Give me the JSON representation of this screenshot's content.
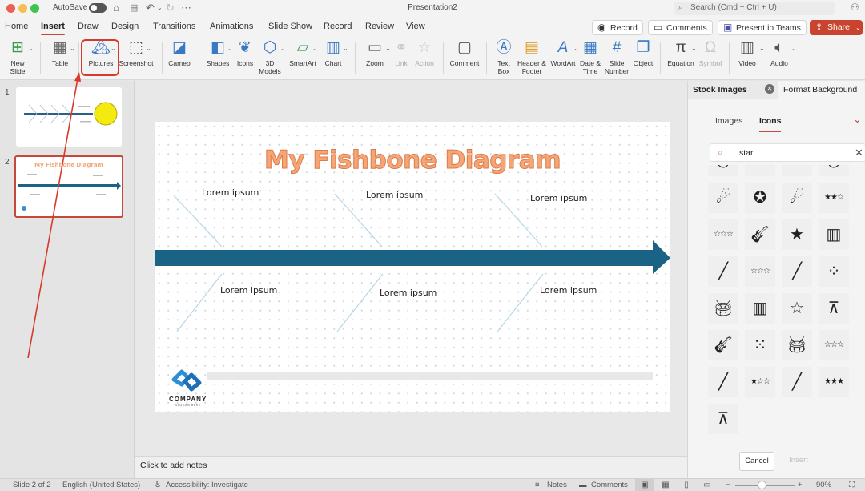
{
  "titlebar": {
    "autosave_label": "AutoSave",
    "autosave_on": false,
    "document_title": "Presentation2",
    "search_placeholder": "Search (Cmd + Ctrl + U)"
  },
  "tabs": [
    {
      "label": "Home"
    },
    {
      "label": "Insert",
      "active": true
    },
    {
      "label": "Draw"
    },
    {
      "label": "Design"
    },
    {
      "label": "Transitions"
    },
    {
      "label": "Animations"
    },
    {
      "label": "Slide Show"
    },
    {
      "label": "Record"
    },
    {
      "label": "Review"
    },
    {
      "label": "View"
    }
  ],
  "actions": {
    "record": "Record",
    "comments": "Comments",
    "present_in_teams": "Present in Teams",
    "share": "Share"
  },
  "ribbon": {
    "new_slide": "New\nSlide",
    "table": "Table",
    "pictures": "Pictures",
    "screenshot": "Screenshot",
    "cameo": "Cameo",
    "shapes": "Shapes",
    "icons": "Icons",
    "models_3d": "3D\nModels",
    "smartart": "SmartArt",
    "chart": "Chart",
    "zoom": "Zoom",
    "link": "Link",
    "action": "Action",
    "comment": "Comment",
    "text_box": "Text\nBox",
    "header_footer": "Header &\nFooter",
    "wordart": "WordArt",
    "date_time": "Date &\nTime",
    "slide_number": "Slide\nNumber",
    "object": "Object",
    "equation": "Equation",
    "symbol": "Symbol",
    "video": "Video",
    "audio": "Audio"
  },
  "slides_panel": {
    "slides": [
      {
        "number": "1",
        "selected": false
      },
      {
        "number": "2",
        "selected": true,
        "title": "My Fishbone Diagram"
      }
    ]
  },
  "slide": {
    "title": "My Fishbone Diagram",
    "labels_top": [
      "Lorem ipsum",
      "Lorem ipsum",
      "Lorem ipsum"
    ],
    "labels_bottom": [
      "Lorem ipsum",
      "Lorem ipsum",
      "Lorem ipsum"
    ],
    "logo_name": "COMPANY",
    "logo_slogan": "SLOGAN HERE",
    "accent_color": "#1a6385",
    "title_color": "#f3a678"
  },
  "notes": {
    "placeholder": "Click to add notes"
  },
  "right_pane": {
    "tab_active": "Stock Images",
    "tab_other": "Format Background",
    "subtabs": [
      "Images",
      "Icons"
    ],
    "active_subtab": "Icons",
    "search_value": "star",
    "icons": [
      "smile-partial-icon",
      "smile-partial-icon-2",
      "small-star-icon",
      "smiley-partial-icon",
      "shooting-star-outline-icon",
      "star-in-circle-icon",
      "shooting-star-filled-icon",
      "two-of-three-stars-icon",
      "two-of-three-stars-outline-icon",
      "electric-guitar-icon",
      "star-filled-icon",
      "piano-keys-icon",
      "flute-outline-icon",
      "three-stars-outline-icon",
      "flute-filled-icon",
      "constellation-icon",
      "drum-kit-outline-icon",
      "piano-keys-outline-icon",
      "star-outline-icon",
      "telescope-filled-icon",
      "electric-guitar-outline-icon",
      "constellation-outline-icon",
      "drum-kit-filled-icon",
      "one-of-three-stars-outline-icon",
      "clarinet-outline-icon",
      "one-of-three-stars-icon",
      "clarinet-filled-icon",
      "three-stars-filled-icon",
      "telescope-outline-icon"
    ],
    "cancel_label": "Cancel",
    "insert_label": "Insert"
  },
  "status": {
    "slide_info": "Slide 2 of 2",
    "language": "English (United States)",
    "accessibility": "Accessibility: Investigate",
    "notes": "Notes",
    "comments": "Comments",
    "zoom_level": "90%",
    "zoom_fraction": 0.45
  },
  "annotation": {
    "highlight_target": "Pictures",
    "color": "#d63a2b"
  }
}
